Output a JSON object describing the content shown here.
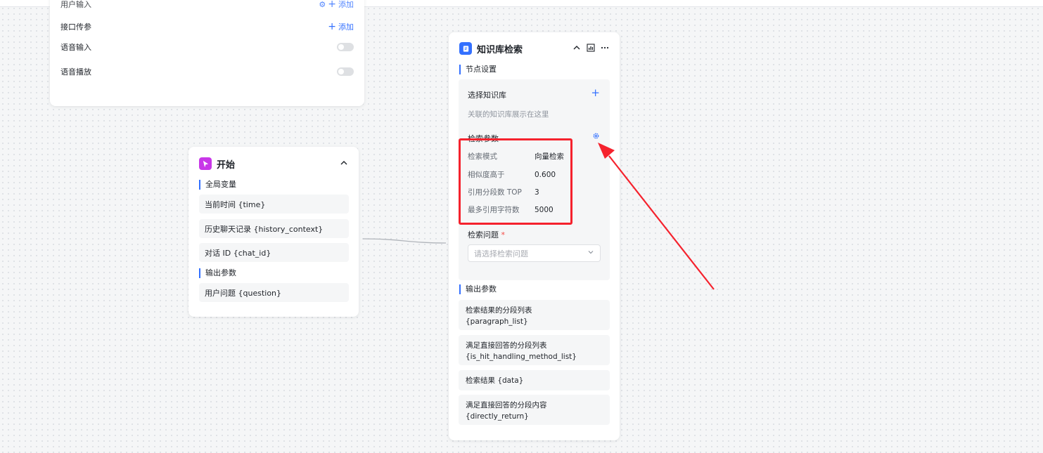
{
  "base_card": {
    "cut_row_label": "用户输入",
    "cut_row_action": "添加",
    "rows": [
      {
        "label": "接口传参",
        "action": "添加"
      },
      {
        "label": "语音输入"
      },
      {
        "label": "语音播放"
      }
    ]
  },
  "start_node": {
    "title": "开始",
    "global_vars_title": "全局变量",
    "global_vars": [
      "当前时间 {time}",
      "历史聊天记录 {history_context}",
      "对话 ID {chat_id}"
    ],
    "output_title": "输出参数",
    "outputs": [
      "用户问题 {question}"
    ]
  },
  "kb_node": {
    "title": "知识库检索",
    "node_settings_title": "节点设置",
    "select_kb_label": "选择知识库",
    "kb_placeholder": "关联的知识库展示在这里",
    "search_params_label": "检索参数",
    "params": [
      {
        "label": "检索模式",
        "value": "向量检索"
      },
      {
        "label": "相似度高于",
        "value": "0.600"
      },
      {
        "label": "引用分段数 TOP",
        "value": "3"
      },
      {
        "label": "最多引用字符数",
        "value": "5000"
      }
    ],
    "question_label": "检索问题",
    "required_mark": "*",
    "question_placeholder": "请选择检索问题",
    "output_title": "输出参数",
    "outputs": [
      {
        "line1": "检索结果的分段列表",
        "line2": "{paragraph_list}"
      },
      {
        "line1": "满足直接回答的分段列表",
        "line2": "{is_hit_handling_method_list}"
      },
      {
        "line1": "检索结果 {data}",
        "line2": ""
      },
      {
        "line1": "满足直接回答的分段内容",
        "line2": "{directly_return}"
      }
    ]
  },
  "icons": {
    "start_node": "cursor-click-icon",
    "kb_node": "book-icon",
    "collapse": "chevron-up-icon",
    "stats": "bar-chart-icon",
    "more": "more-horizontal-icon",
    "add": "plus-icon",
    "settings": "gear-icon",
    "select": "chevron-down-icon"
  },
  "colors": {
    "accent": "#3370ff",
    "start_icon": "#c837e8",
    "kb_icon": "#3370ff",
    "annotation": "#f5222d",
    "required": "#f54a45"
  }
}
